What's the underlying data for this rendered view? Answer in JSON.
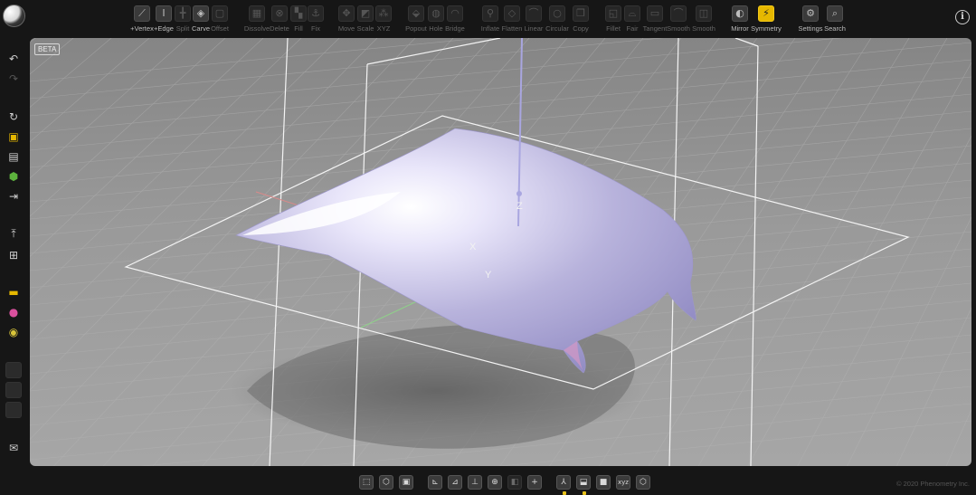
{
  "app": {
    "logo": "phenometry-logo"
  },
  "toolbar": {
    "tools": [
      {
        "id": "vertex",
        "label": "+Vertex",
        "icon": "vertex-icon",
        "glyph": "⟋",
        "dim": false
      },
      {
        "id": "edge",
        "label": "+Edge",
        "icon": "edge-icon",
        "glyph": "I",
        "dim": false
      },
      {
        "id": "split",
        "label": "Split",
        "icon": "split-icon",
        "glyph": "╋",
        "dim": true
      },
      {
        "id": "carve",
        "label": "Carve",
        "icon": "carve-icon",
        "glyph": "◈",
        "dim": false
      },
      {
        "id": "offset",
        "label": "Offset",
        "icon": "offset-icon",
        "glyph": "▢",
        "dim": true
      },
      {
        "id": "dissolve",
        "label": "Dissolve",
        "icon": "dissolve-icon",
        "glyph": "▦",
        "dim": true
      },
      {
        "id": "delete",
        "label": "Delete",
        "icon": "delete-icon",
        "glyph": "⊗",
        "dim": true
      },
      {
        "id": "fill",
        "label": "Fill",
        "icon": "fill-icon",
        "glyph": "▚",
        "dim": true
      },
      {
        "id": "fix",
        "label": "Fix",
        "icon": "fix-icon",
        "glyph": "⚓",
        "dim": true
      },
      {
        "id": "move",
        "label": "Move",
        "icon": "move-icon",
        "glyph": "✥",
        "dim": true
      },
      {
        "id": "scale",
        "label": "Scale",
        "icon": "scale-icon",
        "glyph": "◩",
        "dim": true
      },
      {
        "id": "xyz",
        "label": "XYZ",
        "icon": "xyz-icon",
        "glyph": "⁂",
        "dim": true
      },
      {
        "id": "popout",
        "label": "Popout",
        "icon": "popout-icon",
        "glyph": "⬙",
        "dim": true
      },
      {
        "id": "hole",
        "label": "Hole",
        "icon": "hole-icon",
        "glyph": "◍",
        "dim": true
      },
      {
        "id": "bridge",
        "label": "Bridge",
        "icon": "bridge-icon",
        "glyph": "◠",
        "dim": true
      },
      {
        "id": "inflate",
        "label": "Inflate",
        "icon": "inflate-icon",
        "glyph": "⚲",
        "dim": true
      },
      {
        "id": "flatten",
        "label": "Flatten",
        "icon": "flatten-icon",
        "glyph": "◇",
        "dim": true
      },
      {
        "id": "linear",
        "label": "Linear",
        "icon": "linear-icon",
        "glyph": "⌒",
        "dim": true
      },
      {
        "id": "circular",
        "label": "Circular",
        "icon": "circular-icon",
        "glyph": "○",
        "dim": true
      },
      {
        "id": "copy",
        "label": "Copy",
        "icon": "copy-icon",
        "glyph": "❐",
        "dim": true
      },
      {
        "id": "fillet",
        "label": "Fillet",
        "icon": "fillet-icon",
        "glyph": "◱",
        "dim": true
      },
      {
        "id": "fair",
        "label": "Fair",
        "icon": "fair-icon",
        "glyph": "⌓",
        "dim": true
      },
      {
        "id": "tangent",
        "label": "Tangent",
        "icon": "tangent-icon",
        "glyph": "▭",
        "dim": true
      },
      {
        "id": "smooth1",
        "label": "Smooth",
        "icon": "smooth-curve-icon",
        "glyph": "⌒",
        "dim": true
      },
      {
        "id": "smooth2",
        "label": "Smooth",
        "icon": "smooth-surface-icon",
        "glyph": "◫",
        "dim": true
      },
      {
        "id": "mirror",
        "label": "Mirror",
        "icon": "mirror-icon",
        "glyph": "◐",
        "dim": false
      },
      {
        "id": "symmetry",
        "label": "Symmetry",
        "icon": "symmetry-icon",
        "glyph": "⚡",
        "dim": false,
        "hot": true
      },
      {
        "id": "settings",
        "label": "Settings",
        "icon": "gear-icon",
        "glyph": "⚙",
        "dim": false
      },
      {
        "id": "search",
        "label": "Search",
        "icon": "search-icon",
        "glyph": "⌕",
        "dim": false
      }
    ],
    "info_glyph": "i"
  },
  "sidebar": {
    "items": [
      {
        "id": "undo",
        "icon": "undo-icon",
        "glyph": "↶"
      },
      {
        "id": "redo",
        "icon": "redo-icon",
        "glyph": "↷",
        "dim": true
      },
      {
        "id": "reload",
        "icon": "reload-icon",
        "glyph": "↻"
      },
      {
        "id": "save",
        "icon": "save-icon",
        "glyph": "▣",
        "accent": "#e6b800"
      },
      {
        "id": "save-as",
        "icon": "save-as-icon",
        "glyph": "▤"
      },
      {
        "id": "export",
        "icon": "export-cube-icon",
        "glyph": "⬢",
        "accent": "#5db33d"
      },
      {
        "id": "share",
        "icon": "share-icon",
        "glyph": "⇥"
      },
      {
        "id": "ref",
        "icon": "reference-icon",
        "glyph": "⤒"
      },
      {
        "id": "layers",
        "icon": "layers-icon",
        "glyph": "⊞"
      },
      {
        "id": "folder",
        "icon": "folder-icon",
        "glyph": "▬",
        "accent": "#e6b800"
      },
      {
        "id": "palette",
        "icon": "color-palette-icon",
        "glyph": "●",
        "accent": "#d9509d"
      },
      {
        "id": "material",
        "icon": "material-icon",
        "glyph": "◉",
        "accent": "#d8c43a"
      },
      {
        "id": "slot1",
        "icon": "empty-slot-icon",
        "glyph": "",
        "box": true
      },
      {
        "id": "slot2",
        "icon": "empty-slot-icon",
        "glyph": "",
        "box": true
      },
      {
        "id": "slot3",
        "icon": "empty-slot-icon",
        "glyph": "",
        "box": true
      },
      {
        "id": "mail",
        "icon": "mail-icon",
        "glyph": "✉"
      }
    ]
  },
  "viewport": {
    "badge": "BETA",
    "axes": {
      "x": "X",
      "y": "Y",
      "z": "Z"
    }
  },
  "bottombar": {
    "buttons": [
      {
        "id": "select-frame",
        "icon": "frame-select-icon",
        "glyph": "⬚"
      },
      {
        "id": "view-cube",
        "icon": "cube-view-icon",
        "glyph": "⬡"
      },
      {
        "id": "view-solid",
        "icon": "solid-view-icon",
        "glyph": "▣"
      },
      {
        "id": "view-left",
        "icon": "view-left-icon",
        "glyph": "⊾"
      },
      {
        "id": "view-right",
        "icon": "view-right-icon",
        "glyph": "⊿"
      },
      {
        "id": "view-top",
        "icon": "view-top-icon",
        "glyph": "⊥"
      },
      {
        "id": "zoom",
        "icon": "zoom-icon",
        "glyph": "⊕"
      },
      {
        "id": "flip",
        "icon": "flip-icon",
        "glyph": "◧",
        "dim": true
      },
      {
        "id": "add-point",
        "icon": "add-point-icon",
        "glyph": "+"
      },
      {
        "id": "axes-toggle",
        "icon": "axes-icon",
        "glyph": "⅄",
        "marked": true
      },
      {
        "id": "box-toggle",
        "icon": "box-icon",
        "glyph": "⬓",
        "marked": true
      },
      {
        "id": "shade-toggle",
        "icon": "shade-icon",
        "glyph": "■"
      },
      {
        "id": "xyz-toggle",
        "icon": "xyz-label-icon",
        "glyph": "xyz"
      },
      {
        "id": "wire-cube",
        "icon": "wire-cube-icon",
        "glyph": "⬡"
      }
    ],
    "copyright": "© 2020 Phenometry Inc."
  },
  "colors": {
    "accent": "#e6b800",
    "surface_tint": "#c9c4ea"
  }
}
